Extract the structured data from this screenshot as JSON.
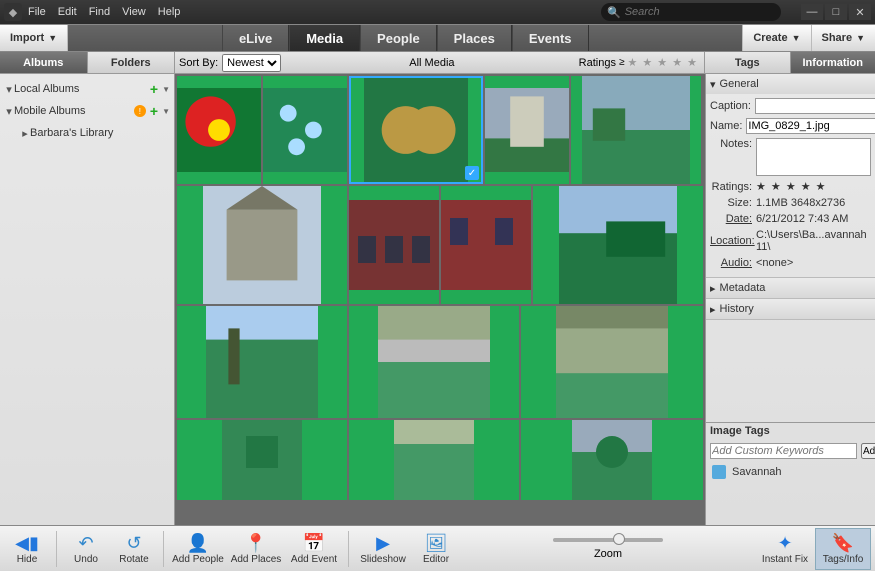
{
  "menu": {
    "file": "File",
    "edit": "Edit",
    "find": "Find",
    "view": "View",
    "help": "Help"
  },
  "search_placeholder": "Search",
  "toolbar": {
    "import": "Import",
    "create": "Create",
    "share": "Share"
  },
  "tabs": {
    "elive": "eLive",
    "media": "Media",
    "people": "People",
    "places": "Places",
    "events": "Events"
  },
  "subtabs_left": {
    "albums": "Albums",
    "folders": "Folders"
  },
  "subtabs_right": {
    "tags": "Tags",
    "information": "Information"
  },
  "sortby_label": "Sort By:",
  "sort_value": "Newest",
  "all_media": "All Media",
  "ratings_label": "Ratings",
  "sidebar": {
    "local": "Local Albums",
    "mobile": "Mobile Albums",
    "mobile_item": "Barbara's Library"
  },
  "info": {
    "general": "General",
    "caption_lbl": "Caption:",
    "caption": "",
    "name_lbl": "Name:",
    "name": "IMG_0829_1.jpg",
    "notes_lbl": "Notes:",
    "notes": "",
    "ratings_lbl": "Ratings:",
    "size_lbl": "Size:",
    "size": "1.1MB  3648x2736",
    "date_lbl": "Date:",
    "date": "6/21/2012 7:43 AM",
    "location_lbl": "Location:",
    "location": "C:\\Users\\Ba...avannah 11\\",
    "audio_lbl": "Audio:",
    "audio": "<none>",
    "metadata": "Metadata",
    "history": "History"
  },
  "imgtags": {
    "title": "Image Tags",
    "placeholder": "Add Custom Keywords",
    "add": "Add",
    "tag1": "Savannah"
  },
  "bottom": {
    "hide": "Hide",
    "undo": "Undo",
    "rotate": "Rotate",
    "addpeople": "Add People",
    "addplaces": "Add Places",
    "addevent": "Add Event",
    "slideshow": "Slideshow",
    "editor": "Editor",
    "zoom": "Zoom",
    "instantfix": "Instant Fix",
    "tagsinfo": "Tags/Info"
  }
}
